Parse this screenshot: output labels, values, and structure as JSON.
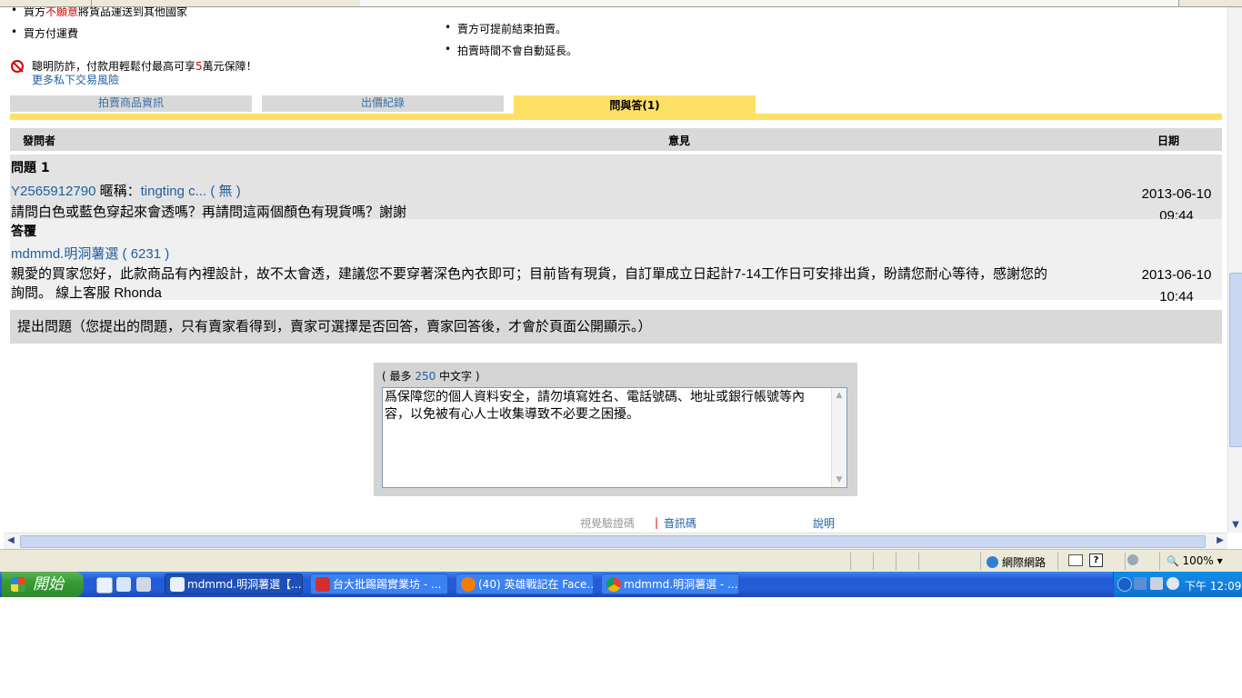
{
  "page": {
    "top_bullets_left": [
      {
        "pre": "買方",
        "red": "不願意",
        "post": "將貨品運送到其他國家"
      },
      {
        "pre": "買方付運費",
        "red": "",
        "post": ""
      }
    ],
    "top_bullets_right": [
      "賣方可提前結束拍賣。",
      "拍賣時間不會自動延長。"
    ],
    "fraud": {
      "icon": "no-entry-icon",
      "text_pre": "聰明防詐，付款用輕鬆付最高可享",
      "text_num": "5",
      "text_post": "萬元保障！",
      "link": "更多私下交易風險"
    },
    "tabs": [
      {
        "label": "拍賣商品資訊",
        "active": false
      },
      {
        "label": "出價紀錄",
        "active": false
      },
      {
        "label": "問與答(1)",
        "active": true
      }
    ],
    "qa_header": {
      "asker": "發問者",
      "opinion": "意見",
      "date": "日期"
    },
    "question": {
      "title": "問題 1",
      "user_id": "Y2565912790",
      "nick_label": "暱稱：",
      "nick": "tingting c...",
      "rating_open": "(",
      "rating": "無",
      "rating_close": ")",
      "text": "請問白色或藍色穿起來會透嗎？再請問這兩個顏色有現貨嗎？謝謝",
      "date": "2013-06-10",
      "time": "09:44"
    },
    "answer": {
      "title": "答覆",
      "seller": "mdmmd.明洞薯選",
      "rating_open": "(",
      "rating": "6231",
      "rating_close": ")",
      "text_line1": "親愛的買家您好，此款商品有內裡設計，故不太會透，建議您不要穿著深色內衣即可；目前皆有現貨，自訂單成立日起計7-14工作日可安排出貨，盼請您耐心等待，感謝您的",
      "text_line2": "詢問。 線上客服 Rhonda",
      "date": "2013-06-10",
      "time": "10:44"
    },
    "ask_bar": "提出問題（您提出的問題，只有賣家看得到，賣家可選擇是否回答，賣家回答後，才會於頁面公開顯示。）",
    "ask_box": {
      "label_pre": "( 最多 ",
      "label_num": "250",
      "label_post": " 中文字 )",
      "placeholder": "爲保障您的個人資料安全，請勿填寫姓名、電話號碼、地址或銀行帳號等內容，以免被有心人士收集導致不必要之困擾。"
    },
    "captcha": {
      "visual": "視覺驗證碼",
      "separator": "|",
      "audio": "音訊碼",
      "help": "說明"
    }
  },
  "statusbar": {
    "zone": "網際網路",
    "zoom": "100%"
  },
  "taskbar": {
    "start": "開始",
    "tasks": [
      {
        "label": "mdmmd.明洞薯選【...",
        "active": true
      },
      {
        "label": "台大批踢踢實業坊 - ...",
        "active": false
      },
      {
        "label": "(40) 英雄戰記在 Face...",
        "active": false
      },
      {
        "label": "mdmmd.明洞薯選 - ...",
        "active": false
      }
    ],
    "clock": "下午 12:09"
  },
  "colors": {
    "tab_active": "#ffe066",
    "link": "#1f5fa0",
    "alert_red": "#d40000",
    "taskbar": "#245dd7",
    "start_green": "#379b34"
  }
}
